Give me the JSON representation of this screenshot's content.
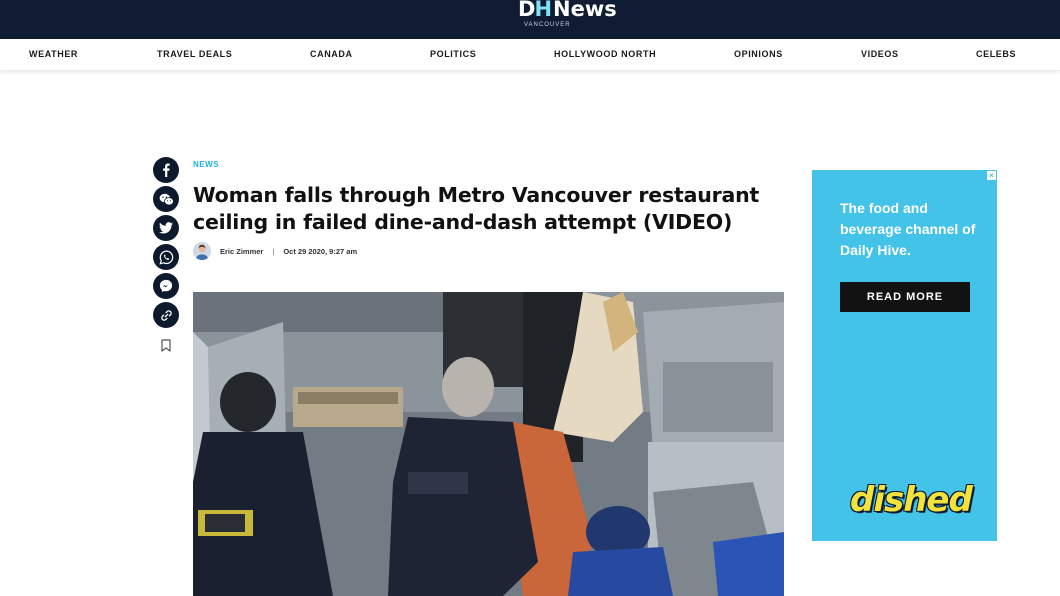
{
  "header": {
    "logo_dh_d": "D",
    "logo_dh_h": "H",
    "logo_news": "News",
    "logo_city": "VANCOUVER"
  },
  "nav": {
    "items": [
      "WEATHER",
      "TRAVEL DEALS",
      "CANADA",
      "POLITICS",
      "HOLLYWOOD NORTH",
      "OPINIONS",
      "VIDEOS",
      "CELEBS"
    ]
  },
  "share": {
    "icons": [
      "facebook-icon",
      "wechat-icon",
      "twitter-icon",
      "whatsapp-icon",
      "messenger-icon",
      "link-icon",
      "bookmark-icon"
    ]
  },
  "article": {
    "category": "NEWS",
    "headline": "Woman falls through Metro Vancouver restaurant ceiling in failed dine-and-dash attempt (VIDEO)",
    "author": "Eric Zimmer",
    "separator": "|",
    "date": "Oct 29 2020, 9:27 am"
  },
  "ad": {
    "copy": "The food and beverage channel of Daily Hive.",
    "cta": "READ MORE",
    "brand": "dished",
    "close": "×"
  },
  "colors": {
    "header_bg": "#0f1c33",
    "accent": "#1fb3d9",
    "ad_bg": "#43c3e7",
    "brand_yellow": "#f3e33c"
  }
}
